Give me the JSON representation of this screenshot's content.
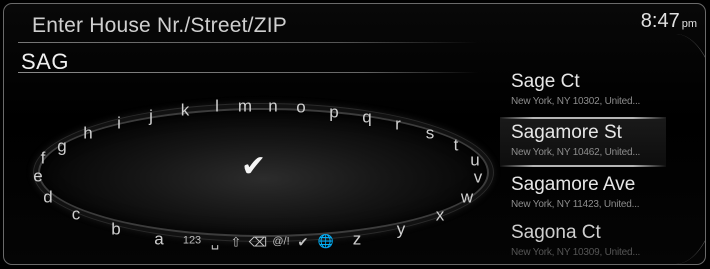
{
  "header": {
    "title": "Enter House Nr./Street/ZIP"
  },
  "clock": {
    "time": "8:47",
    "ampm": "pm"
  },
  "search": {
    "value": "SAG"
  },
  "keyboard": {
    "confirm_icon": "checkmark-icon",
    "letters": [
      "a",
      "b",
      "c",
      "d",
      "e",
      "f",
      "g",
      "h",
      "i",
      "j",
      "k",
      "l",
      "m",
      "n",
      "o",
      "p",
      "q",
      "r",
      "s",
      "t",
      "u",
      "v",
      "w",
      "x",
      "y",
      "z"
    ],
    "mode_123": "123",
    "space_icon": "space-icon",
    "shift_icon": "shift-icon",
    "backspace_icon": "backspace-icon",
    "symbols": "@/!",
    "enter_icon": "checkmark-icon",
    "globe_icon": "globe-icon"
  },
  "results": [
    {
      "name": "Sage Ct",
      "address": "New York, NY 10302, United..."
    },
    {
      "name": "Sagamore St",
      "address": "New York, NY 10462, United..."
    },
    {
      "name": "Sagamore Ave",
      "address": "New York, NY 11423, United..."
    },
    {
      "name": "Sagona Ct",
      "address": "New York, NY 10309, United..."
    }
  ]
}
